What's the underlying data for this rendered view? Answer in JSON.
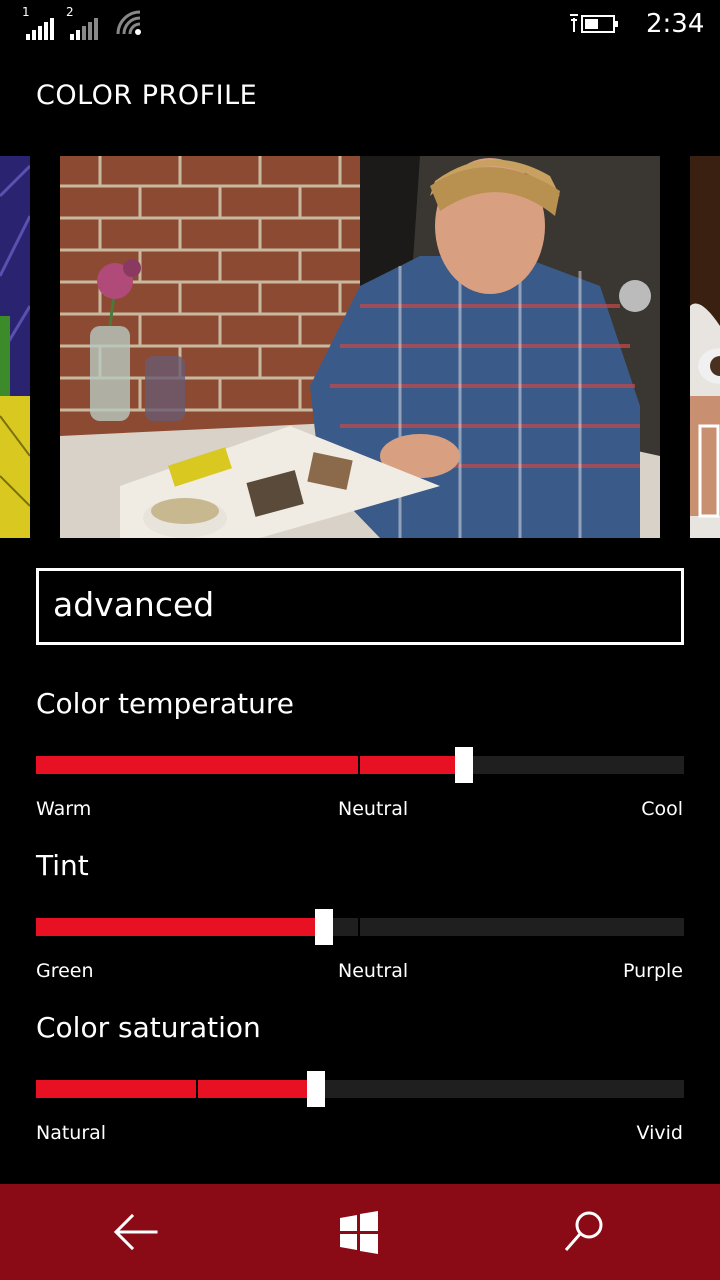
{
  "status": {
    "sim1": "1",
    "sim2": "2",
    "time": "2:34"
  },
  "page": {
    "title": "COLOR PROFILE"
  },
  "profile": {
    "value": "advanced"
  },
  "sliders": [
    {
      "label": "Color temperature",
      "left": "Warm",
      "center": "Neutral",
      "right": "Cool",
      "value_fraction": 0.66
    },
    {
      "label": "Tint",
      "left": "Green",
      "center": "Neutral",
      "right": "Purple",
      "value_fraction": 0.445
    },
    {
      "label": "Color saturation",
      "left": "Natural",
      "right": "Vivid",
      "value_fraction": 0.432
    }
  ],
  "colors": {
    "accent": "#e81123",
    "nav": "#8a0a16",
    "track": "#1f1f1f"
  },
  "icons": {
    "back": "back-arrow-icon",
    "start": "windows-logo-icon",
    "search": "search-icon"
  }
}
